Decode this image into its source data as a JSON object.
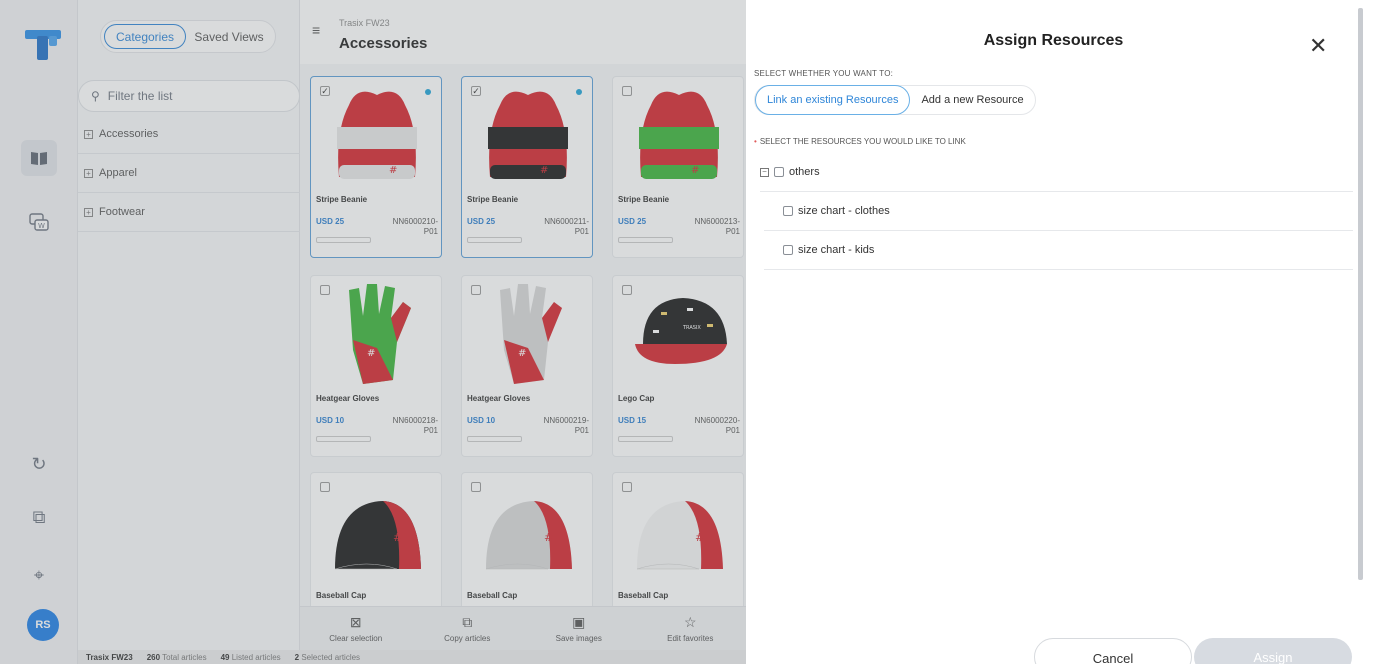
{
  "left_rail": {
    "icons": [
      "book-icon",
      "chat-w-icon",
      "refresh-icon",
      "layers-icon",
      "pin-icon"
    ],
    "avatar_initials": "RS",
    "accent": "#1f7ee6"
  },
  "categories_panel": {
    "tab_active": "Categories",
    "tab_inactive": "Saved Views",
    "filter_placeholder": "Filter the list",
    "items": [
      "Accessories",
      "Apparel",
      "Footwear"
    ]
  },
  "grid": {
    "subtitle": "Trasix FW23",
    "title": "Accessories",
    "cards": [
      {
        "name": "Stripe Beanie",
        "price": "USD 25",
        "code1": "NN6000210-",
        "code2": "P01",
        "checked": true,
        "dot": true,
        "product": "beanie",
        "colors": [
          "#d6262f",
          "#e8e8e8"
        ]
      },
      {
        "name": "Stripe Beanie",
        "price": "USD 25",
        "code1": "NN6000211-",
        "code2": "P01",
        "checked": true,
        "dot": true,
        "product": "beanie",
        "colors": [
          "#d6262f",
          "#1b1b1b"
        ]
      },
      {
        "name": "Stripe Beanie",
        "price": "USD 25",
        "code1": "NN6000213-",
        "code2": "P01",
        "checked": false,
        "dot": false,
        "product": "beanie",
        "colors": [
          "#d6262f",
          "#3bb53a"
        ]
      },
      {
        "name": "Heatgear Gloves",
        "price": "USD 10",
        "code1": "NN6000218-",
        "code2": "P01",
        "checked": false,
        "dot": false,
        "product": "glove",
        "colors": [
          "#3bb53a",
          "#d6262f"
        ]
      },
      {
        "name": "Heatgear Gloves",
        "price": "USD 10",
        "code1": "NN6000219-",
        "code2": "P01",
        "checked": false,
        "dot": false,
        "product": "glove",
        "colors": [
          "#d9d9d9",
          "#d6262f"
        ]
      },
      {
        "name": "Lego Cap",
        "price": "USD 15",
        "code1": "NN6000220-",
        "code2": "P01",
        "checked": false,
        "dot": false,
        "product": "lego",
        "colors": [
          "#1b1b1b",
          "#d6262f"
        ]
      },
      {
        "name": "Baseball Cap",
        "price": "",
        "code1": "",
        "code2": "",
        "checked": false,
        "dot": false,
        "product": "cap",
        "colors": [
          "#1b1b1b",
          "#d6262f"
        ]
      },
      {
        "name": "Baseball Cap",
        "price": "",
        "code1": "",
        "code2": "",
        "checked": false,
        "dot": false,
        "product": "cap",
        "colors": [
          "#d9d9d9",
          "#d6262f"
        ]
      },
      {
        "name": "Baseball Cap",
        "price": "",
        "code1": "",
        "code2": "",
        "checked": false,
        "dot": false,
        "product": "cap",
        "colors": [
          "#f4f4f4",
          "#d6262f"
        ]
      }
    ],
    "footer_actions": [
      {
        "label": "Clear selection",
        "icon": "clear-selection-icon",
        "glyph": "⊠"
      },
      {
        "label": "Copy articles",
        "icon": "copy-icon",
        "glyph": "⧉"
      },
      {
        "label": "Save images",
        "icon": "save-images-icon",
        "glyph": "▣"
      },
      {
        "label": "Edit favorites",
        "icon": "star-icon",
        "glyph": "☆"
      }
    ]
  },
  "status_bar": {
    "collection": "Trasix FW23",
    "total_count": "260",
    "total_label": "Total articles",
    "listed_count": "49",
    "listed_label": "Listed articles",
    "selected_count": "2",
    "selected_label": "Selected articles"
  },
  "modal": {
    "title": "Assign Resources",
    "close_glyph": "✕",
    "question1": "SELECT WHETHER YOU WANT TO:",
    "option_link": "Link an existing Resources",
    "option_add": "Add a new Resource",
    "question2": "SELECT THE RESOURCES YOU WOULD LIKE TO LINK",
    "tree": {
      "group": "others",
      "children": [
        "size chart - clothes",
        "size chart - kids"
      ]
    },
    "cancel_label": "Cancel",
    "assign_label": "Assign"
  }
}
